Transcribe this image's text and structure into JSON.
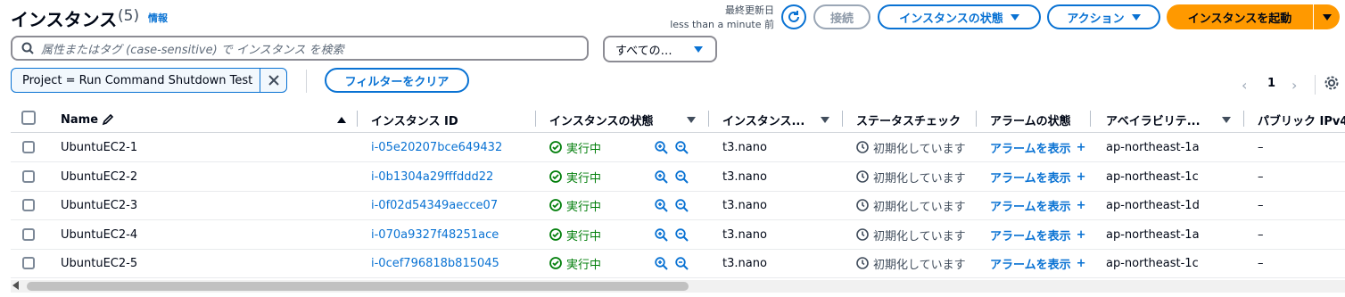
{
  "header": {
    "title": "インスタンス",
    "count": "(5)",
    "info_link": "情報",
    "updated_label": "最終更新日",
    "updated_time": "less than a minute 前",
    "connect_label": "接続",
    "state_label": "インスタンスの状態",
    "actions_label": "アクション",
    "launch_label": "インスタンスを起動"
  },
  "search": {
    "placeholder": "属性またはタグ (case-sensitive) で インスタンス を検索",
    "scope_select": "すべての…"
  },
  "filter": {
    "token": "Project = Run Command Shutdown Test",
    "clear_label": "フィルターをクリア"
  },
  "pagination": {
    "page": "1",
    "prev": "‹",
    "next": "›"
  },
  "table": {
    "columns": [
      "Name",
      "インスタンス ID",
      "インスタンスの状態",
      "インスタンス...",
      "ステータスチェック",
      "アラームの状態",
      "アベイラビリテ...",
      "パブリック IPv4"
    ],
    "rows": [
      {
        "name": "UbuntuEC2-1",
        "id": "i-05e20207bce649432",
        "state": "実行中",
        "type": "t3.nano",
        "status": "初期化しています",
        "alarm": "アラームを表示",
        "az": "ap-northeast-1a",
        "ipv4": "–"
      },
      {
        "name": "UbuntuEC2-2",
        "id": "i-0b1304a29fffddd22",
        "state": "実行中",
        "type": "t3.nano",
        "status": "初期化しています",
        "alarm": "アラームを表示",
        "az": "ap-northeast-1c",
        "ipv4": "–"
      },
      {
        "name": "UbuntuEC2-3",
        "id": "i-0f02d54349aecce07",
        "state": "実行中",
        "type": "t3.nano",
        "status": "初期化しています",
        "alarm": "アラームを表示",
        "az": "ap-northeast-1d",
        "ipv4": "–"
      },
      {
        "name": "UbuntuEC2-4",
        "id": "i-070a9327f48251ace",
        "state": "実行中",
        "type": "t3.nano",
        "status": "初期化しています",
        "alarm": "アラームを表示",
        "az": "ap-northeast-1a",
        "ipv4": "–"
      },
      {
        "name": "UbuntuEC2-5",
        "id": "i-0cef796818b815045",
        "state": "実行中",
        "type": "t3.nano",
        "status": "初期化しています",
        "alarm": "アラームを表示",
        "az": "ap-northeast-1c",
        "ipv4": "–"
      }
    ]
  },
  "colors": {
    "accent": "#0972d3",
    "launch": "#ff9900",
    "running": "#037f0c"
  }
}
